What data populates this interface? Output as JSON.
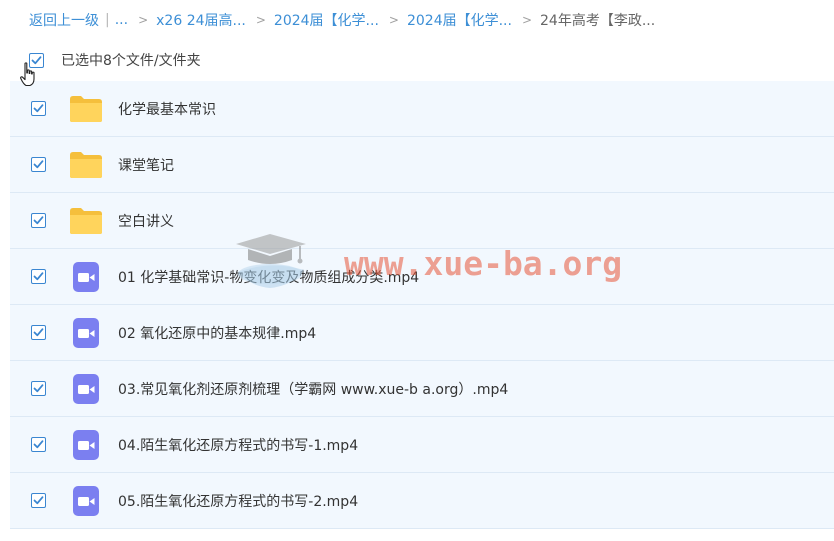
{
  "breadcrumb": {
    "back": "返回上一级",
    "separator": "|",
    "ellipsis": "...",
    "items": [
      "x26 24届高...",
      "2024届【化学...",
      "2024届【化学..."
    ],
    "current": "24年高考【李政..."
  },
  "selection": {
    "text": "已选中8个文件/文件夹"
  },
  "files": [
    {
      "name": "化学最基本常识",
      "type": "folder"
    },
    {
      "name": "课堂笔记",
      "type": "folder"
    },
    {
      "name": "空白讲义",
      "type": "folder"
    },
    {
      "name": "01 化学基础常识-物变化变及物质组成分类.mp4",
      "type": "video"
    },
    {
      "name": "02 氧化还原中的基本规律.mp4",
      "type": "video"
    },
    {
      "name": "03.常见氧化剂还原剂梳理（学霸网 www.xue-b a.org）.mp4",
      "type": "video"
    },
    {
      "name": "04.陌生氧化还原方程式的书写-1.mp4",
      "type": "video"
    },
    {
      "name": "05.陌生氧化还原方程式的书写-2.mp4",
      "type": "video"
    }
  ],
  "watermark": {
    "text": "www.xue-ba.org"
  },
  "colors": {
    "link": "#3d8fd6",
    "row_bg": "#f2f8fe",
    "checkbox": "#3a86d1",
    "folder": "#ffd45c",
    "video": "#7b7ff0",
    "watermark": "#e8583a"
  },
  "icons": {
    "folder": "folder-icon",
    "video": "video-file-icon",
    "cursor": "hand-pointer-icon",
    "check": "checkmark-icon"
  }
}
